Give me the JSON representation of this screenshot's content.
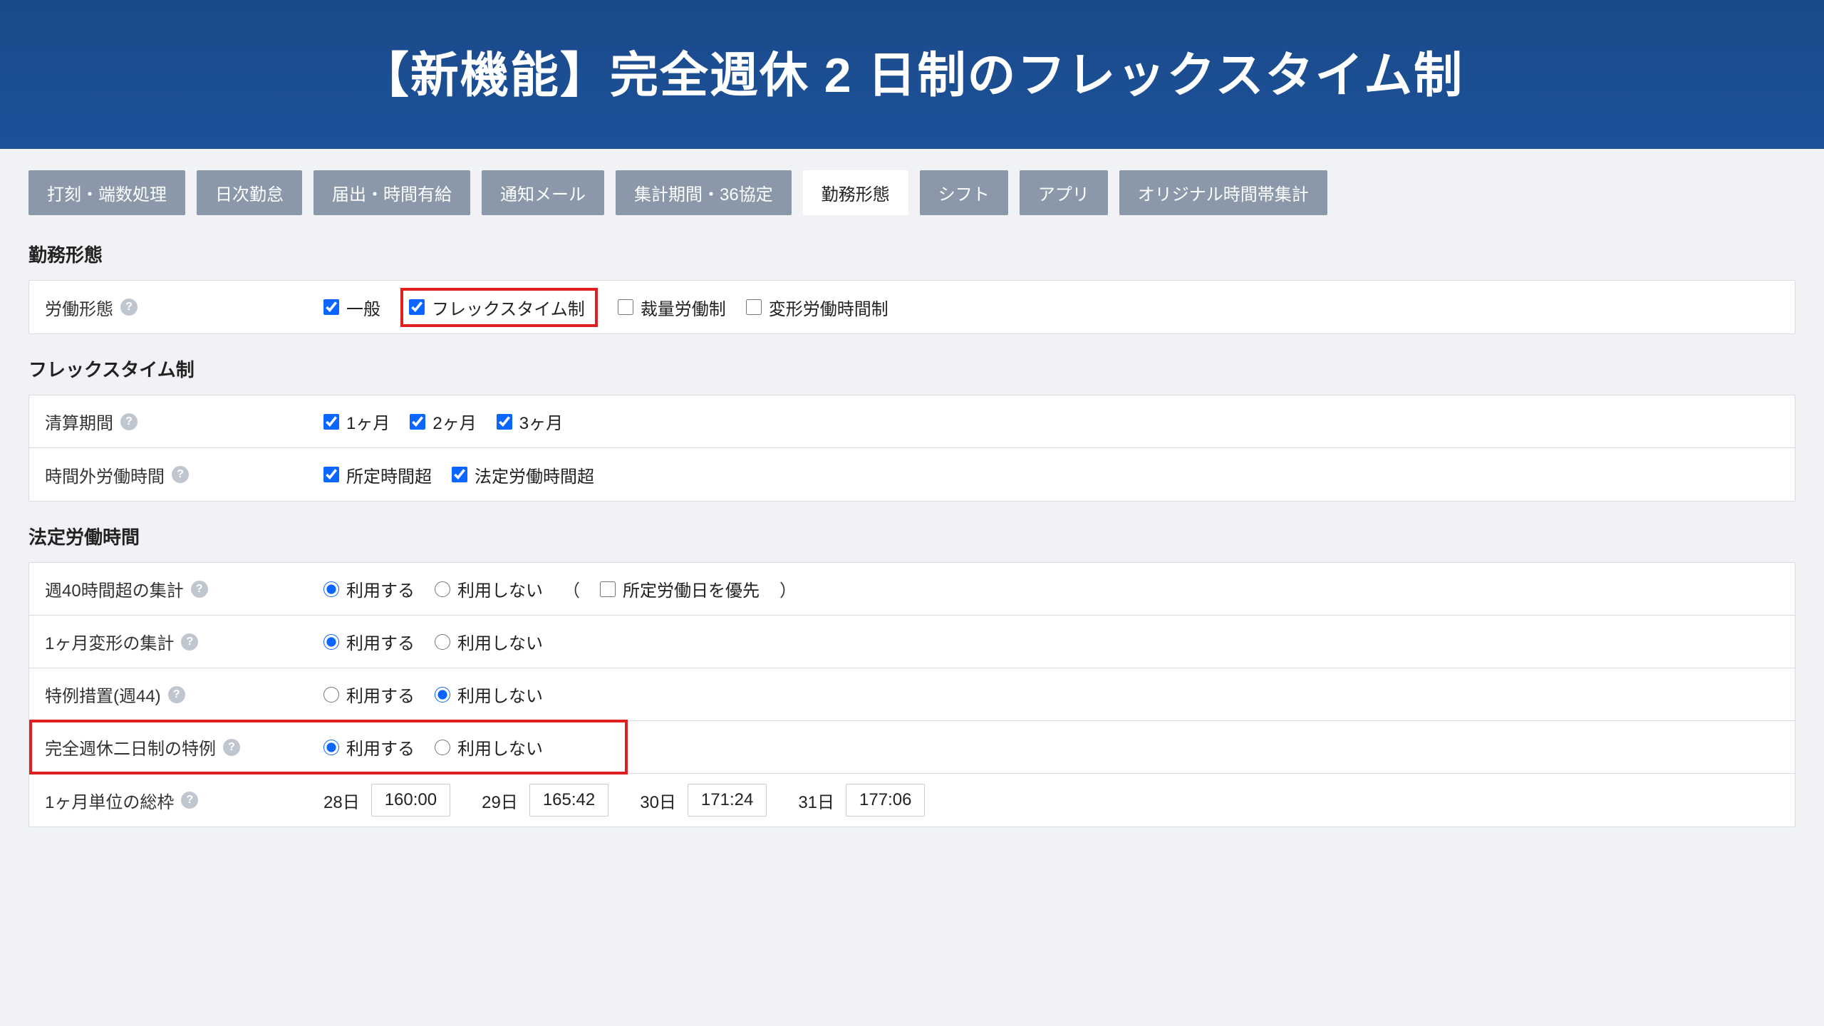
{
  "banner": {
    "title": "【新機能】完全週休 2 日制のフレックスタイム制"
  },
  "tabs": [
    {
      "label": "打刻・端数処理",
      "active": false
    },
    {
      "label": "日次勤怠",
      "active": false
    },
    {
      "label": "届出・時間有給",
      "active": false
    },
    {
      "label": "通知メール",
      "active": false
    },
    {
      "label": "集計期間・36協定",
      "active": false
    },
    {
      "label": "勤務形態",
      "active": true
    },
    {
      "label": "シフト",
      "active": false
    },
    {
      "label": "アプリ",
      "active": false
    },
    {
      "label": "オリジナル時間帯集計",
      "active": false
    }
  ],
  "sections": {
    "workStyle": {
      "title": "勤務形態",
      "row1": {
        "label": "労働形態",
        "opts": {
          "general": "一般",
          "flex": "フレックスタイム制",
          "discretion": "裁量労働制",
          "variable": "変形労働時間制"
        }
      }
    },
    "flex": {
      "title": "フレックスタイム制",
      "period": {
        "label": "清算期間",
        "m1": "1ヶ月",
        "m2": "2ヶ月",
        "m3": "3ヶ月"
      },
      "overtime": {
        "label": "時間外労働時間",
        "o1": "所定時間超",
        "o2": "法定労働時間超"
      }
    },
    "legal": {
      "title": "法定労働時間",
      "r1": {
        "label": "週40時間超の集計",
        "use": "利用する",
        "nouse": "利用しない",
        "paren_open": "（",
        "paren_close": "）",
        "priority": "所定労働日を優先"
      },
      "r2": {
        "label": "1ヶ月変形の集計",
        "use": "利用する",
        "nouse": "利用しない"
      },
      "r3": {
        "label": "特例措置(週44)",
        "use": "利用する",
        "nouse": "利用しない"
      },
      "r4": {
        "label": "完全週休二日制の特例",
        "use": "利用する",
        "nouse": "利用しない"
      },
      "r5": {
        "label": "1ヶ月単位の総枠",
        "days": [
          {
            "d": "28日",
            "t": "160:00"
          },
          {
            "d": "29日",
            "t": "165:42"
          },
          {
            "d": "30日",
            "t": "171:24"
          },
          {
            "d": "31日",
            "t": "177:06"
          }
        ]
      }
    }
  }
}
